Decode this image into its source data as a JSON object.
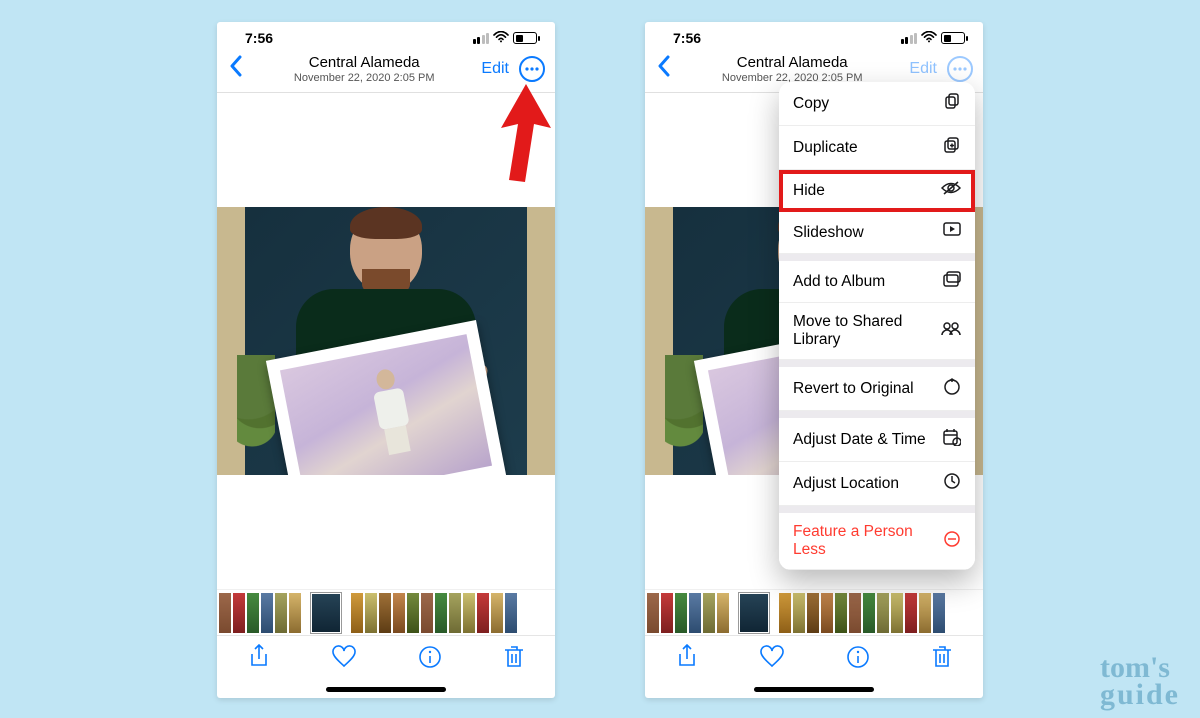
{
  "statusbar": {
    "time": "7:56"
  },
  "header": {
    "title": "Central Alameda",
    "subtitle": "November 22, 2020  2:05 PM",
    "edit_label": "Edit"
  },
  "menu": {
    "items": [
      {
        "label": "Copy",
        "icon": "copy-icon"
      },
      {
        "label": "Duplicate",
        "icon": "duplicate-icon"
      },
      {
        "label": "Hide",
        "icon": "hide-icon",
        "highlight": true
      },
      {
        "label": "Slideshow",
        "icon": "slideshow-icon"
      }
    ],
    "group2": [
      {
        "label": "Add to Album",
        "icon": "album-icon"
      },
      {
        "label": "Move to Shared Library",
        "icon": "shared-library-icon"
      }
    ],
    "group3": [
      {
        "label": "Revert to Original",
        "icon": "revert-icon"
      }
    ],
    "group4": [
      {
        "label": "Adjust Date & Time",
        "icon": "date-time-icon"
      },
      {
        "label": "Adjust Location",
        "icon": "location-icon"
      }
    ],
    "group5": [
      {
        "label": "Feature a Person Less",
        "icon": "minus-circle-icon",
        "destructive": true
      }
    ]
  },
  "watermark": {
    "line1": "tom's",
    "line2": "guide"
  }
}
